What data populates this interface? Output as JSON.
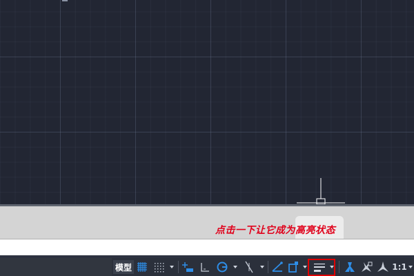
{
  "annotation": {
    "text": "点击一下让它成为高亮状态",
    "color": "#e0001a"
  },
  "status_bar": {
    "model_label": "模型",
    "scale_label": "1:1",
    "highlight_color": "#e00000",
    "icons": [
      "grid-display-icon",
      "snap-mode-icon",
      "dynamic-input-icon",
      "ortho-mode-icon",
      "polar-tracking-icon",
      "isometric-drafting-icon",
      "object-snap-tracking-icon",
      "object-snap-icon",
      "lineweight-icon",
      "annotation-visibility-icon",
      "auto-scale-icon",
      "annotation-scale-icon"
    ]
  },
  "colors": {
    "canvas_background": "#222633",
    "command_area": "#d4d4d4",
    "status_bar_background": "#2b303b",
    "accent_blue": "#2e8ee8"
  }
}
